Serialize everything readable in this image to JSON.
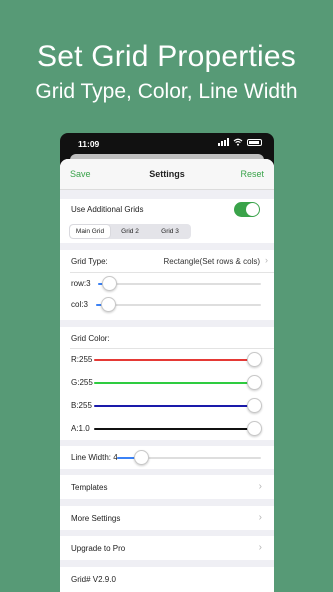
{
  "promo": {
    "title": "Set Grid Properties",
    "subtitle": "Grid Type, Color, Line Width"
  },
  "status_bar": {
    "time": "11:09"
  },
  "nav": {
    "save": "Save",
    "title": "Settings",
    "reset": "Reset"
  },
  "additional_grids": {
    "label": "Use Additional Grids",
    "enabled": true,
    "tabs": [
      "Main Grid",
      "Grid 2",
      "Grid 3"
    ],
    "selected_tab": "Main Grid"
  },
  "grid_type": {
    "label": "Grid Type:",
    "value": "Rectangle(Set rows & cols)",
    "row": {
      "label": "row:3",
      "fraction": 0.07
    },
    "col": {
      "label": "col:3",
      "fraction": 0.07
    }
  },
  "grid_color": {
    "label": "Grid Color:",
    "channels": [
      {
        "label": "R:255",
        "color": "#e53935",
        "fraction": 1.0
      },
      {
        "label": "G:255",
        "color": "#2ecc40",
        "fraction": 1.0
      },
      {
        "label": "B:255",
        "color": "#1a1aaa",
        "fraction": 1.0
      },
      {
        "label": "A:1.0",
        "color": "#111111",
        "fraction": 1.0
      }
    ]
  },
  "line_width": {
    "label": "Line Width: 4",
    "fraction": 0.17,
    "color": "#3b82f6"
  },
  "menu": {
    "templates": "Templates",
    "more_settings": "More Settings",
    "upgrade": "Upgrade to Pro",
    "version": "Grid# V2.9.0"
  },
  "colors": {
    "accent": "#3aa34a",
    "background": "#579a76",
    "slider_blue": "#3b82f6"
  }
}
